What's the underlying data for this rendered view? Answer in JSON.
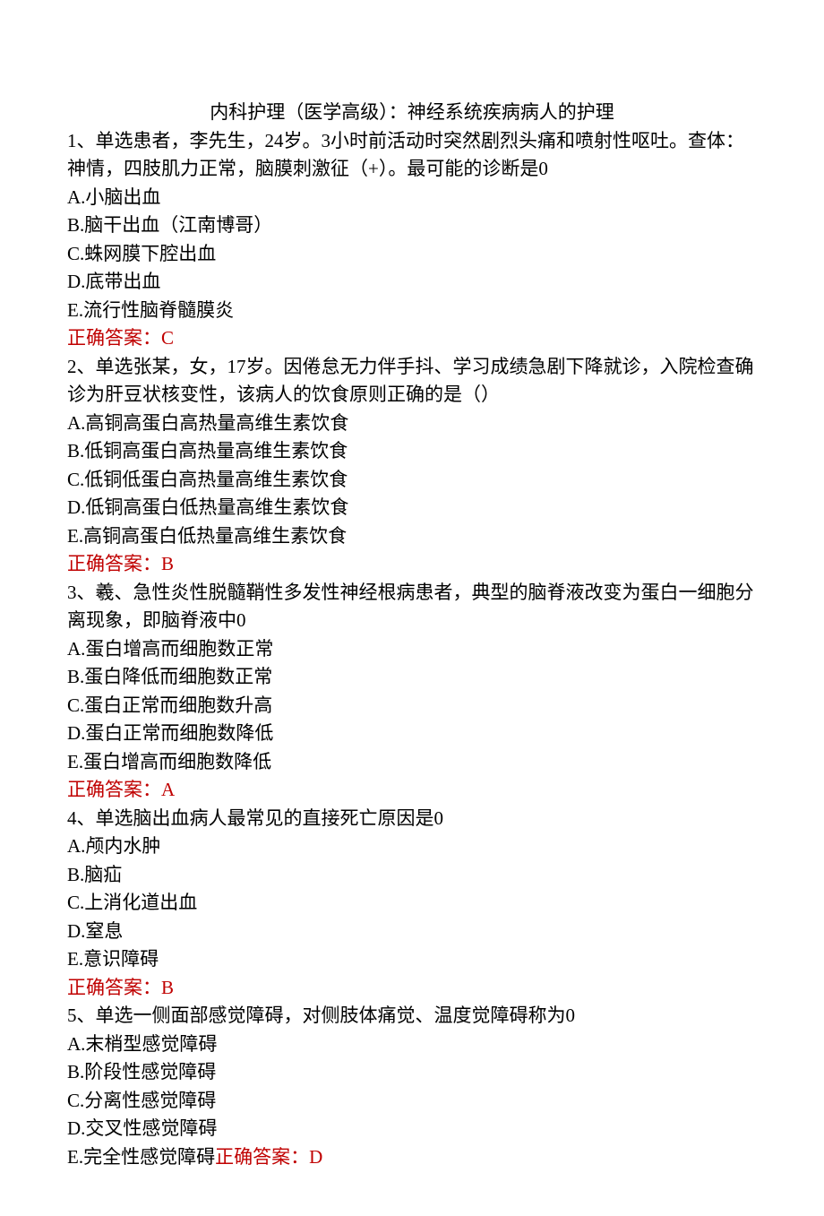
{
  "title": "内科护理（医学高级）：神经系统疾病病人的护理",
  "questions": [
    {
      "stem": "1、单选患者，李先生，24岁。3小时前活动时突然剧烈头痛和喷射性呕吐。查体：神情，四肢肌力正常，脑膜刺激征（+）。最可能的诊断是0",
      "options": [
        "A.小脑出血",
        "B.脑干出血（江南博哥）",
        "C.蛛网膜下腔出血",
        "D.底带出血",
        "E.流行性脑脊髓膜炎"
      ],
      "answer": "正确答案：C"
    },
    {
      "stem": "2、单选张某，女，17岁。因倦怠无力伴手抖、学习成绩急剧下降就诊，入院检查确诊为肝豆状核变性，该病人的饮食原则正确的是（）",
      "options": [
        "A.高铜高蛋白高热量高维生素饮食",
        "B.低铜高蛋白高热量高维生素饮食",
        "C.低铜低蛋白高热量高维生素饮食",
        "D.低铜高蛋白低热量高维生素饮食",
        "E.高铜高蛋白低热量高维生素饮食"
      ],
      "answer": "正确答案：B"
    },
    {
      "stem": "3、羲、急性炎性脱髓鞘性多发性神经根病患者，典型的脑脊液改变为蛋白一细胞分离现象，即脑脊液中0",
      "options": [
        "A.蛋白增高而细胞数正常",
        "B.蛋白降低而细胞数正常",
        "C.蛋白正常而细胞数升高",
        "D.蛋白正常而细胞数降低",
        "E.蛋白增高而细胞数降低"
      ],
      "answer": "正确答案：A"
    },
    {
      "stem": "4、单选脑出血病人最常见的直接死亡原因是0",
      "options": [
        "A.颅内水肿",
        "B.脑疝",
        "C.上消化道出血",
        "D.窒息",
        "E.意识障碍"
      ],
      "answer": "正确答案：B"
    },
    {
      "stem": "5、单选一侧面部感觉障碍，对侧肢体痛觉、温度觉障碍称为0",
      "options": [
        "A.末梢型感觉障碍",
        "B.阶段性感觉障碍",
        "C.分离性感觉障碍",
        "D.交叉性感觉障碍"
      ],
      "lastOption": "E.完全性感觉障碍",
      "inlineAnswer": "正确答案：D"
    }
  ]
}
